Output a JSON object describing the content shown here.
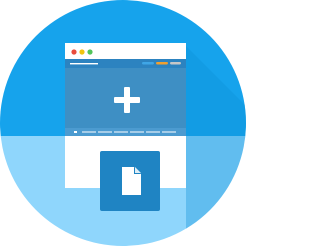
{
  "icon": {
    "name": "add-new-page-icon",
    "colors": {
      "background": "#ffffff",
      "circle_top": "#16a3ec",
      "circle_bottom": "#8fd6fc",
      "long_shadow": "#0b8fd6",
      "window_frame": "#ffffff",
      "window_header": "#2c83c0",
      "window_header_line": "#ffffff",
      "traffic_light_red": "#e94b3c",
      "traffic_light_yellow": "#f1c40f",
      "traffic_light_green": "#52c45a",
      "header_bar_blue": "#3fa6e6",
      "header_bar_orange": "#f0a030",
      "header_bar_dark": "#c7c7c7",
      "content_panel": "#3e8fc4",
      "plus_sign": "#ffffff",
      "thumbnail_strip": "#4c9bd0",
      "thumbnail_item": "#ffffff",
      "file_tile": "#1f84c3",
      "file_glyph": "#ffffff"
    },
    "parts": [
      "circle-background",
      "browser-window-icon",
      "plus-icon",
      "file-icon"
    ]
  }
}
